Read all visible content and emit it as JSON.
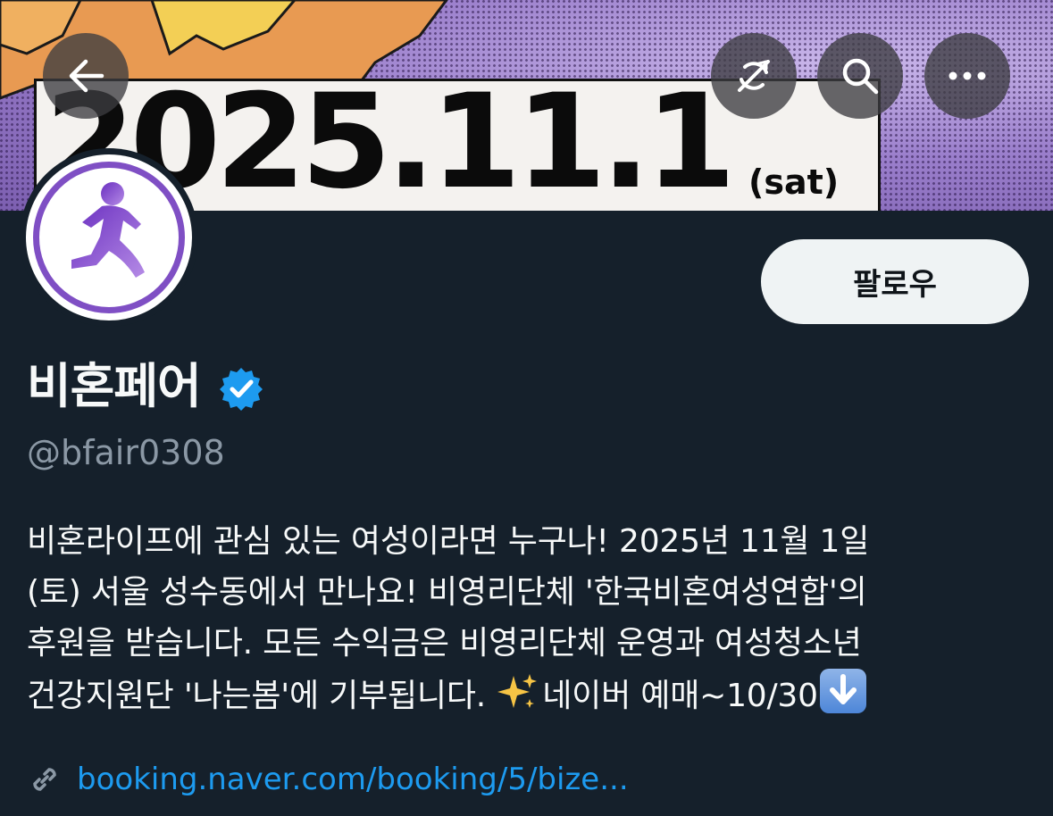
{
  "banner": {
    "date_text": "2025.11.1",
    "day_text": "(sat)"
  },
  "top_actions": {
    "back_icon": "arrow-left-icon",
    "mute_icon": "notification-off-icon",
    "search_icon": "search-icon",
    "more_icon": "more-horizontal-icon"
  },
  "profile": {
    "display_name": "비혼페어",
    "handle": "@bfair0308",
    "verified_icon": "verified-badge-icon",
    "follow_label": "팔로우",
    "bio_lines": [
      "비혼라이프에 관심 있는 여성이라면 누구나! 2025년 11월 1일",
      "(토) 서울 성수동에서 만나요! 비영리단체 '한국비혼여성연합'의",
      "후원을 받습니다. 모든 수익금은 비영리단체 운영과 여성청소년",
      "건강지원단 '나는봄'에 기부됩니다.",
      "네이버 예매~10/30"
    ],
    "link_icon": "link-icon",
    "link": "booking.naver.com/booking/5/bize..."
  },
  "colors": {
    "background": "#15202b",
    "accent_link": "#1d9bf0",
    "secondary_text": "#8b98a5",
    "verified": "#1d9bf0",
    "avatar_ring": "#7f4fc4"
  }
}
